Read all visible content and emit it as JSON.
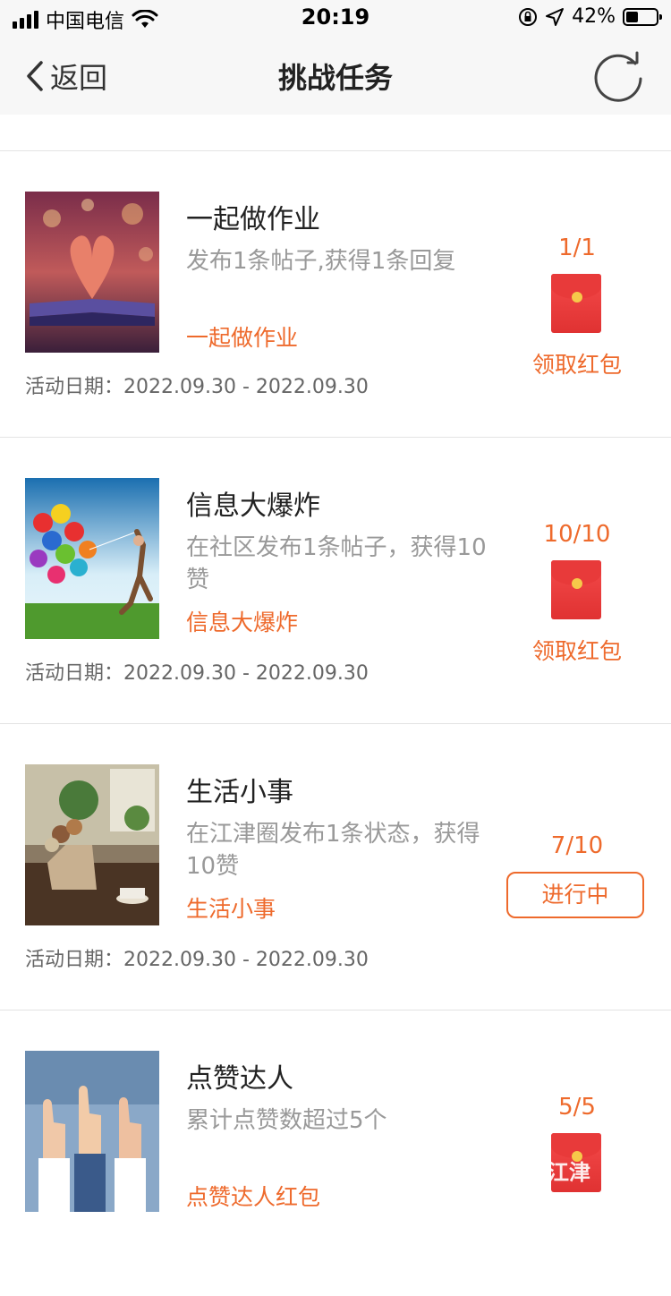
{
  "status_bar": {
    "carrier": "中国电信",
    "time": "20:19",
    "battery": "42%"
  },
  "nav": {
    "back_label": "返回",
    "title": "挑战任务"
  },
  "tasks": [
    {
      "title": "一起做作业",
      "description": "发布1条帖子,获得1条回复",
      "tag": "一起做作业",
      "date": "活动日期：2022.09.30 - 2022.09.30",
      "progress": "1/1",
      "action": "领取红包"
    },
    {
      "title": "信息大爆炸",
      "description": "在社区发布1条帖子，获得10赞",
      "tag": "信息大爆炸",
      "date": "活动日期：2022.09.30 - 2022.09.30",
      "progress": "10/10",
      "action": "领取红包"
    },
    {
      "title": "生活小事",
      "description": "在江津圈发布1条状态，获得10赞",
      "tag": "生活小事",
      "date": "活动日期：2022.09.30 - 2022.09.30",
      "progress": "7/10",
      "action": "进行中"
    },
    {
      "title": "点赞达人",
      "description": "累计点赞数超过5个",
      "tag": "点赞达人红包",
      "progress": "5/5"
    }
  ],
  "watermark": "江津",
  "colors": {
    "accent": "#ee6a2c",
    "envelope": "#f04040",
    "bar_bg": "#f7f7f7"
  }
}
